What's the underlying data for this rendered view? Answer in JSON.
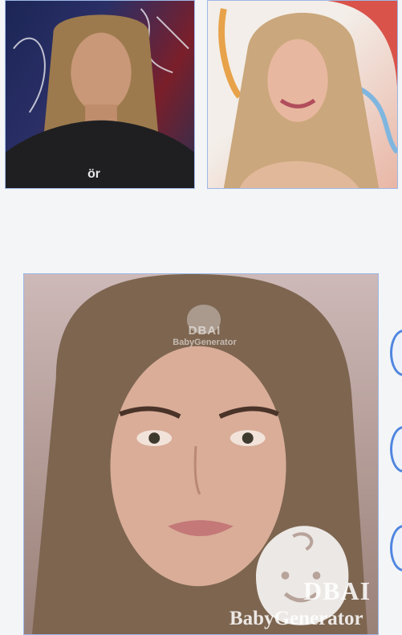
{
  "parents": {
    "father_alt": "Father photo",
    "mother_alt": "Mother photo",
    "father_shirt_text": "ör"
  },
  "result": {
    "alt": "Generated baby face"
  },
  "watermark": {
    "brand": "DBAI",
    "name": "BabyGenerator"
  },
  "side_buttons": [
    "option-1",
    "option-2",
    "option-3"
  ],
  "colors": {
    "background": "#f4f5f7",
    "photo_border": "#9db8e6",
    "accent": "#4f86e0"
  }
}
